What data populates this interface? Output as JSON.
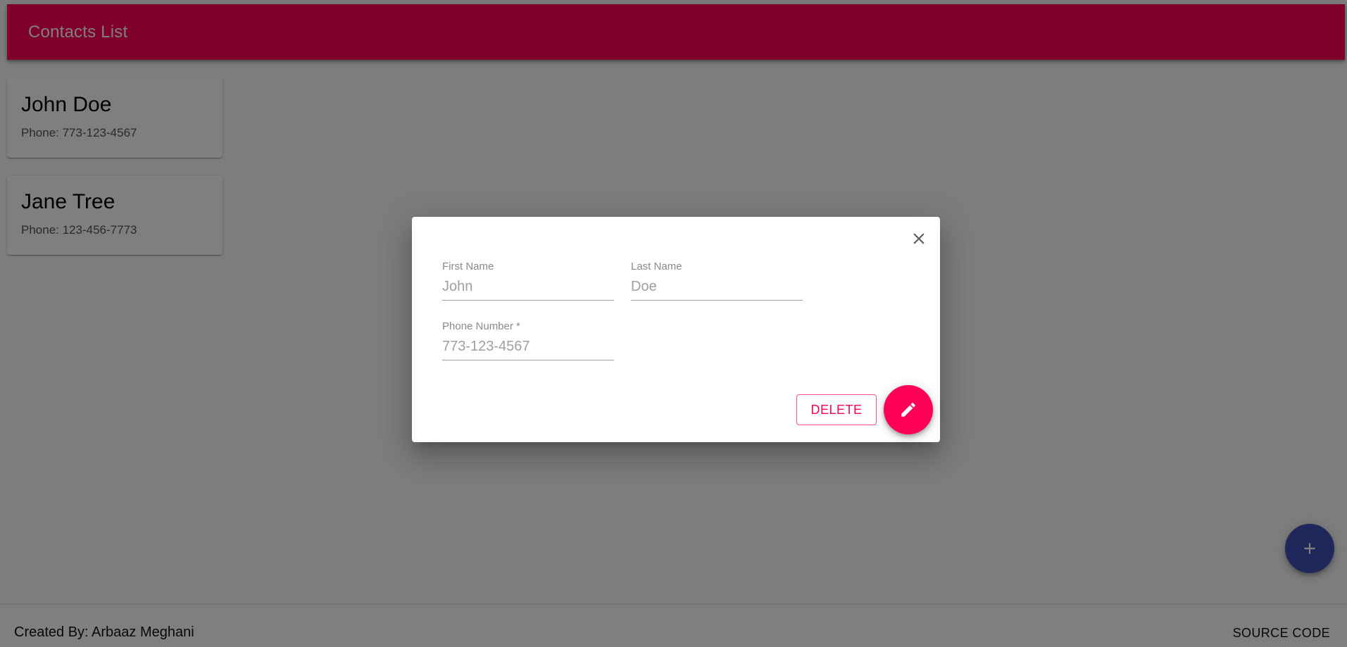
{
  "appbar": {
    "title": "Contacts List",
    "color": "#ff0057"
  },
  "contacts": [
    {
      "name": "John Doe",
      "phone": "Phone: 773-123-4567"
    },
    {
      "name": "Jane Tree",
      "phone": "Phone: 123-456-7773"
    }
  ],
  "footer": {
    "credit": "Created By: Arbaaz Meghani",
    "source_label": "SOURCE CODE"
  },
  "add_fab": {
    "icon": "plus-icon",
    "color": "#3f51b5"
  },
  "dialog": {
    "close_icon": "close-icon",
    "fields": {
      "first_name": {
        "label": "First Name",
        "value": "John"
      },
      "last_name": {
        "label": "Last Name",
        "value": "Doe"
      },
      "phone": {
        "label": "Phone Number *",
        "value": "773-123-4567"
      }
    },
    "delete_label": "DELETE",
    "edit_fab": {
      "icon": "pencil-icon",
      "color": "#ff0057"
    }
  }
}
